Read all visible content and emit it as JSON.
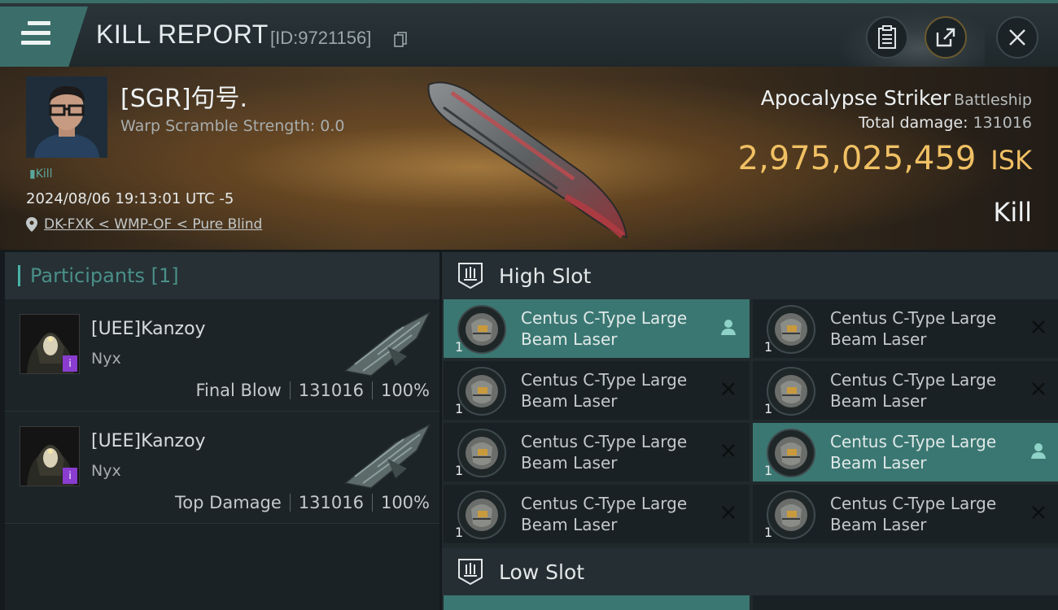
{
  "header": {
    "title": "KILL REPORT",
    "report_id": "[ID:9721156]"
  },
  "victim": {
    "name": "[SGR]句号.",
    "warp_scramble": "Warp Scramble Strength: 0.0",
    "tag": "Kill",
    "datetime": "2024/08/06 19:13:01 UTC -5",
    "location": "DK-FXK < WMP-OF < Pure Blind",
    "ship_name": "Apocalypse Striker",
    "ship_class": "Battleship",
    "total_damage_label": "Total damage:",
    "total_damage": "131016",
    "isk_value": "2,975,025,459",
    "isk_unit": "ISK",
    "result": "Kill"
  },
  "participants": {
    "header": "Participants [1]",
    "rows": [
      {
        "name": "[UEE]Kanzoy",
        "ship": "Nyx",
        "role": "Final Blow",
        "damage": "131016",
        "percent": "100%",
        "badge": "i"
      },
      {
        "name": "[UEE]Kanzoy",
        "ship": "Nyx",
        "role": "Top Damage",
        "damage": "131016",
        "percent": "100%",
        "badge": "i"
      }
    ]
  },
  "slots": {
    "high_label": "High Slot",
    "low_label": "Low Slot",
    "module_name_line1": "Centus C-Type Large",
    "module_name_line2": "Beam Laser",
    "module_qty": "1",
    "high_modules": [
      {
        "state": "pilot"
      },
      {
        "state": "destroyed"
      },
      {
        "state": "destroyed"
      },
      {
        "state": "destroyed"
      },
      {
        "state": "destroyed"
      },
      {
        "state": "pilot"
      },
      {
        "state": "destroyed"
      },
      {
        "state": "destroyed"
      }
    ]
  },
  "colors": {
    "accent_teal": "#3b7772",
    "isk_gold": "#f0c064",
    "badge_purple": "#8a3ccf"
  }
}
